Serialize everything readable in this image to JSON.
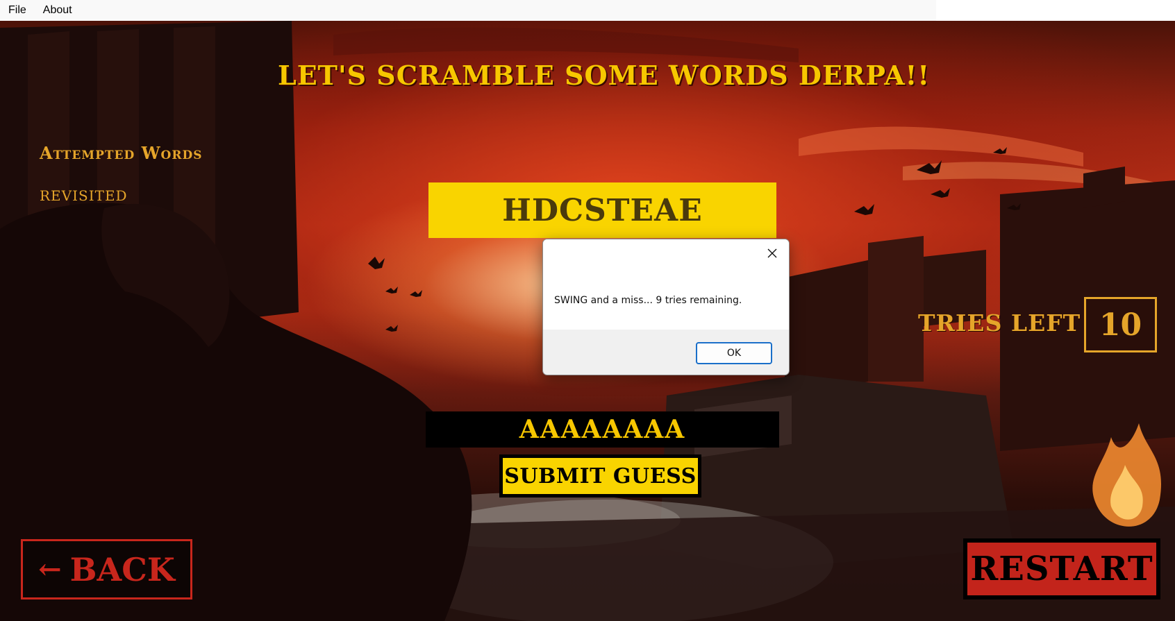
{
  "menu": {
    "file": "File",
    "about": "About"
  },
  "game": {
    "title": "LET'S SCRAMBLE SOME WORDS DERPA!!",
    "attempted_title": "Attempted Words",
    "attempted_words": [
      "REVISITED"
    ],
    "scrambled_word": "HDCSTEAE",
    "tries_label": "TRIES LEFT",
    "tries_left": "10",
    "guess_value": "AAAAAAAA",
    "submit_label": "SUBMIT GUESS",
    "back_arrow": "←",
    "back_label": "BACK",
    "restart_label": "RESTART"
  },
  "dialog": {
    "message": "SWING and a miss... 9 tries remaining.",
    "ok_label": "OK",
    "close_icon": "close-icon"
  },
  "colors": {
    "accent_yellow": "#f9d400",
    "gold_text": "#e5a52a",
    "restart_red": "#c3241b",
    "back_red": "#c8261c",
    "dialog_focus_blue": "#1a6fc9"
  }
}
